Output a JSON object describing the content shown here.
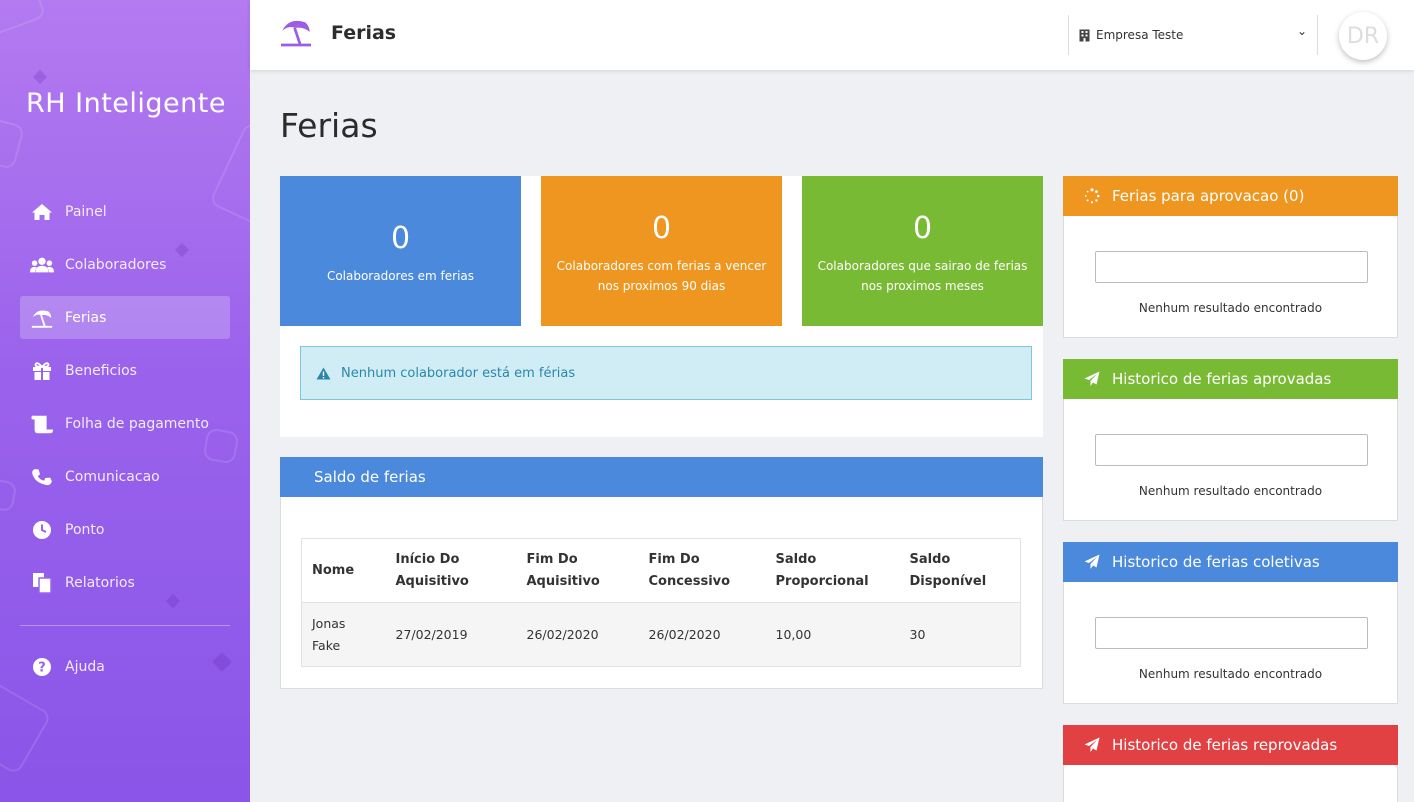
{
  "brand": "RH Inteligente",
  "sidebar": {
    "items": [
      {
        "label": "Painel",
        "icon": "home-icon"
      },
      {
        "label": "Colaboradores",
        "icon": "users-icon"
      },
      {
        "label": "Ferias",
        "icon": "beach-umbrella-icon",
        "active": true
      },
      {
        "label": "Beneficios",
        "icon": "gift-icon"
      },
      {
        "label": "Folha de pagamento",
        "icon": "scroll-icon"
      },
      {
        "label": "Comunicacao",
        "icon": "phone-icon"
      },
      {
        "label": "Ponto",
        "icon": "clock-icon"
      },
      {
        "label": "Relatorios",
        "icon": "copy-icon"
      }
    ],
    "help": {
      "label": "Ajuda",
      "icon": "question-circle-icon"
    }
  },
  "header": {
    "title": "Ferias",
    "company": "Empresa Teste",
    "avatar_initials": "DR"
  },
  "page_title": "Ferias",
  "stats": [
    {
      "value": "0",
      "label": "Colaboradores em ferias",
      "color": "#4b89dc"
    },
    {
      "value": "0",
      "label": "Colaboradores com ferias a vencer nos proximos 90 dias",
      "color": "#ee961f"
    },
    {
      "value": "0",
      "label": "Colaboradores que sairao de ferias nos proximos meses",
      "color": "#79ba35"
    }
  ],
  "alert": "Nenhum colaborador está em férias",
  "saldo": {
    "title": "Saldo de ferias",
    "columns": [
      "Nome",
      "Início Do Aquisitivo",
      "Fim Do Aquisitivo",
      "Fim Do Concessivo",
      "Saldo Proporcional",
      "Saldo Disponível"
    ],
    "rows": [
      [
        "Jonas Fake",
        "27/02/2019",
        "26/02/2020",
        "26/02/2020",
        "10,00",
        "30"
      ]
    ]
  },
  "cards": [
    {
      "title": "Ferias para aprovacao (0)",
      "empty": "Nenhum resultado encontrado",
      "color": "#ee961f",
      "icon": "spinner-icon"
    },
    {
      "title": "Historico de ferias aprovadas",
      "empty": "Nenhum resultado encontrado",
      "color": "#79ba35",
      "icon": "paper-plane-icon"
    },
    {
      "title": "Historico de ferias coletivas",
      "empty": "Nenhum resultado encontrado",
      "color": "#4b89dc",
      "icon": "paper-plane-icon"
    },
    {
      "title": "Historico de ferias reprovadas",
      "empty": "",
      "color": "#e24144",
      "icon": "paper-plane-icon"
    }
  ]
}
